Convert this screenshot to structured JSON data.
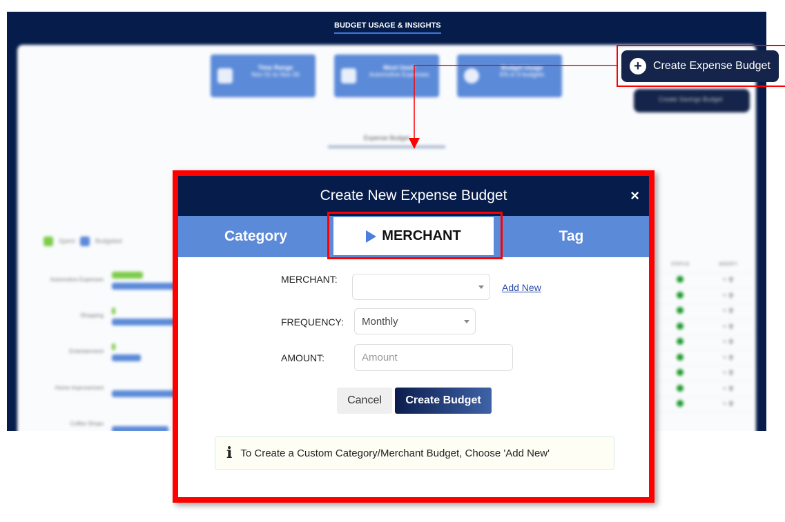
{
  "background": {
    "title": "BUDGET USAGE & INSIGHTS",
    "cards": [
      {
        "title": "Time Range",
        "sub": "Nov 01 to Nov 06"
      },
      {
        "title": "Most Used",
        "sub": "Automotive Expenses"
      },
      {
        "title": "Budget Usage",
        "sub": "6% in 9 budgets"
      }
    ],
    "savings_button": "Create Savings Budget",
    "expense_tab": "Expense Budget",
    "legend": [
      "Spent",
      "Budgeted"
    ],
    "categories": [
      "Automotive Expenses",
      "Shopping",
      "Entertainment",
      "Home Improvement",
      "Coffee Shops"
    ],
    "table_headers": [
      "STATUS",
      "MODIFY"
    ],
    "rows": 9,
    "colors": {
      "spent": "#7dcc4a",
      "budgeted": "#5b8ad8",
      "status": "#1e9a2e"
    }
  },
  "callout": {
    "button": "Create Expense Budget",
    "icon": "plus-circle-icon"
  },
  "modal": {
    "title": "Create New Expense Budget",
    "close": "×",
    "tabs": [
      "Category",
      "MERCHANT",
      "Tag"
    ],
    "active_tab": "MERCHANT",
    "fields": {
      "merchant_label": "MERCHANT:",
      "merchant_value": "",
      "add_new": "Add New",
      "frequency_label": "FREQUENCY:",
      "frequency_value": "Monthly",
      "amount_label": "AMOUNT:",
      "amount_placeholder": "Amount"
    },
    "cancel": "Cancel",
    "create": "Create Budget",
    "info": "To Create a Custom Category/Merchant Budget, Choose 'Add New'",
    "info_icon": "info-icon"
  }
}
